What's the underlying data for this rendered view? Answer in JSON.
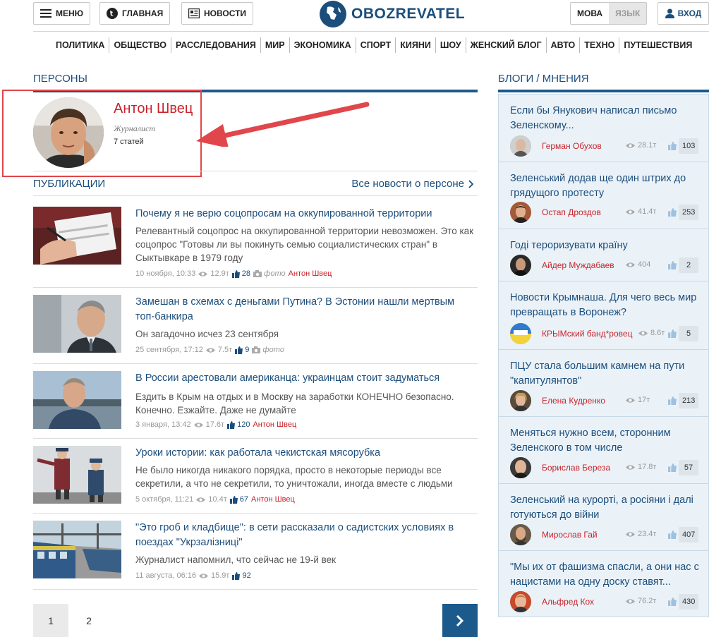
{
  "header": {
    "menu_label": "МЕНЮ",
    "home_label": "ГЛАВНАЯ",
    "news_label": "НОВОСТИ",
    "logo_text": "OBOZREVATEL",
    "lang_active": "МОВА",
    "lang_inactive": "ЯЗЫК",
    "login_label": "ВХОД"
  },
  "nav": [
    "ПОЛИТИКА",
    "ОБЩЕСТВО",
    "РАССЛЕДОВАНИЯ",
    "МИР",
    "ЭКОНОМИКА",
    "СПОРТ",
    "КИЯНИ",
    "ШОУ",
    "ЖЕНСКИЙ БЛОГ",
    "АВТО",
    "ТЕХНО",
    "ПУТЕШЕСТВИЯ"
  ],
  "persons": {
    "section_title": "ПЕРСОНЫ",
    "name": "Антон Швец",
    "role": "Журналист",
    "count": "7 статей"
  },
  "publications": {
    "section_title": "ПУБЛИКАЦИИ",
    "all_link": "Все новости о персоне",
    "items": [
      {
        "title": "Почему я не верю соцопросам на оккупированной территории",
        "lead": "Релевантный соцопрос на оккупированной территории невозможен. Это как соцопрос \"Готовы ли вы покинуть семью социалистических стран\" в Сыктывкаре в 1979 году",
        "date": "10 ноября, 10:33",
        "views": "12.9т",
        "likes": "28",
        "photo": "фото",
        "author": "Антон Швец"
      },
      {
        "title": "Замешан в схемах с деньгами Путина? В Эстонии нашли мертвым топ-банкира",
        "lead": "Он загадочно исчез 23 сентября",
        "date": "25 сентября, 17:12",
        "views": "7.5т",
        "likes": "9",
        "photo": "фото",
        "author": ""
      },
      {
        "title": "В России арестовали американца: украинцам стоит задуматься",
        "lead": "Ездить в Крым на отдых и в Москву на заработки КОНЕЧНО безопасно. Конечно. Езжайте. Даже не думайте",
        "date": "3 января, 13:42",
        "views": "17.6т",
        "likes": "120",
        "photo": "",
        "author": "Антон Швец"
      },
      {
        "title": "Уроки истории: как работала чекистская мясорубка",
        "lead": "Не было никогда никакого порядка, просто в некоторые периоды все секретили, а что не секретили, то уничтожали, иногда вместе с людьми",
        "date": "5 октября, 11:21",
        "views": "10.4т",
        "likes": "67",
        "photo": "",
        "author": "Антон Швец"
      },
      {
        "title": "\"Это гроб и кладбище\": в сети рассказали о садистских условиях в поездах \"Укрзалізниці\"",
        "lead": "Журналист напомнил, что сейчас не 19-й век",
        "date": "11 августа, 06:16",
        "views": "15.9т",
        "likes": "92",
        "photo": "",
        "author": ""
      }
    ]
  },
  "pagination": {
    "current": "1",
    "next_page": "2"
  },
  "blogs": {
    "section_title": "БЛОГИ / МНЕНИЯ",
    "items": [
      {
        "title": "Если бы Янукович написал письмо Зеленскому...",
        "author": "Герман Обухов",
        "views": "28.1т",
        "likes": "103"
      },
      {
        "title": "Зеленський додав ще один штрих до грядущого протесту",
        "author": "Остап Дроздов",
        "views": "41.4т",
        "likes": "253"
      },
      {
        "title": "Годі тероризувати країну",
        "author": "Айдер Муждабаев",
        "views": "404",
        "likes": "2"
      },
      {
        "title": "Новости Крымнаша. Для чего весь мир превращать в Воронеж?",
        "author": "КРЫМский банд*ровец",
        "views": "8.6т",
        "likes": "5"
      },
      {
        "title": "ПЦУ стала большим камнем на пути \"капитулянтов\"",
        "author": "Елена Кудренко",
        "views": "17т",
        "likes": "213"
      },
      {
        "title": "Меняться нужно всем, сторонним Зеленского в том числе",
        "author": "Борислав Береза",
        "views": "17.8т",
        "likes": "57"
      },
      {
        "title": "Зеленський на курорті, а росіяни і далі готуються до війни",
        "author": "Мирослав Гай",
        "views": "23.4т",
        "likes": "407"
      },
      {
        "title": "\"Мы их от фашизма спасли, а они нас с нацистами на одну доску ставят...",
        "author": "Альфред Кох",
        "views": "76.2т",
        "likes": "430"
      }
    ]
  },
  "colors": {
    "brand_blue": "#1c4e7c",
    "accent_red": "#c9242b",
    "highlight_red": "#e0464b"
  },
  "icons": [
    "hamburger-icon",
    "globe-icon",
    "newspaper-icon",
    "user-icon",
    "eye-icon",
    "thumbs-up-icon",
    "camera-icon",
    "chevron-right-icon",
    "arrow-annotation"
  ]
}
